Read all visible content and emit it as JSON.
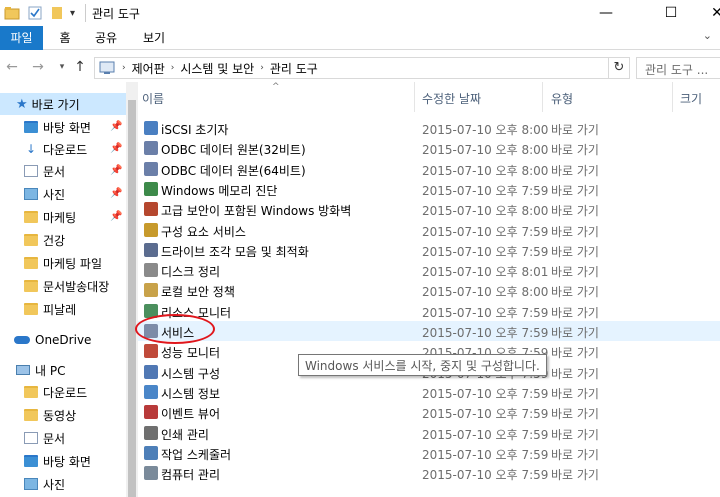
{
  "window": {
    "title": "관리 도구",
    "minimize": "—",
    "maximize": "☐",
    "close": "✕"
  },
  "ribbon": {
    "tabs": [
      "파일",
      "홈",
      "공유",
      "보기"
    ],
    "expand": "⌄"
  },
  "address": {
    "crumbs": [
      "제어판",
      "시스템 및 보안",
      "관리 도구"
    ],
    "search_placeholder": "관리 도구 ..."
  },
  "nav": {
    "quick_access": "바로 가기",
    "pinned": [
      "바탕 화면",
      "다운로드",
      "문서",
      "사진",
      "마케팅"
    ],
    "folders": [
      "건강",
      "마케팅 파일",
      "문서발송대장",
      "피날레"
    ],
    "onedrive": "OneDrive",
    "this_pc": "내 PC",
    "pc_items": [
      "다운로드",
      "동영상",
      "문서",
      "바탕 화면",
      "사진"
    ]
  },
  "columns": {
    "name": "이름",
    "date": "수정한 날짜",
    "type": "유형",
    "size": "크기"
  },
  "files": [
    {
      "name": "iSCSI 초기자",
      "date": "2015-07-10 오후 8:00",
      "type": "바로 가기",
      "color": "#4a7fc1"
    },
    {
      "name": "ODBC 데이터 원본(32비트)",
      "date": "2015-07-10 오후 8:00",
      "type": "바로 가기",
      "color": "#6b7fa8"
    },
    {
      "name": "ODBC 데이터 원본(64비트)",
      "date": "2015-07-10 오후 8:00",
      "type": "바로 가기",
      "color": "#6b7fa8"
    },
    {
      "name": "Windows 메모리 진단",
      "date": "2015-07-10 오후 7:59",
      "type": "바로 가기",
      "color": "#3d8a4a"
    },
    {
      "name": "고급 보안이 포함된 Windows 방화벽",
      "date": "2015-07-10 오후 8:00",
      "type": "바로 가기",
      "color": "#b5472e"
    },
    {
      "name": "구성 요소 서비스",
      "date": "2015-07-10 오후 7:59",
      "type": "바로 가기",
      "color": "#c79a2c"
    },
    {
      "name": "드라이브 조각 모음 및 최적화",
      "date": "2015-07-10 오후 7:59",
      "type": "바로 가기",
      "color": "#5b6c8f"
    },
    {
      "name": "디스크 정리",
      "date": "2015-07-10 오후 8:01",
      "type": "바로 가기",
      "color": "#8a8a8a"
    },
    {
      "name": "로컬 보안 정책",
      "date": "2015-07-10 오후 8:00",
      "type": "바로 가기",
      "color": "#c8a24a"
    },
    {
      "name": "리소스 모니터",
      "date": "2015-07-10 오후 7:59",
      "type": "바로 가기",
      "color": "#4b8f5d"
    },
    {
      "name": "서비스",
      "date": "2015-07-10 오후 7:59",
      "type": "바로 가기",
      "color": "#7d8ca8"
    },
    {
      "name": "성능 모니터",
      "date": "2015-07-10 오후 7:59",
      "type": "바로 가기",
      "color": "#c04a3a"
    },
    {
      "name": "시스템 구성",
      "date": "2015-07-10 오후 7:59",
      "type": "바로 가기",
      "color": "#5078b4"
    },
    {
      "name": "시스템 정보",
      "date": "2015-07-10 오후 7:59",
      "type": "바로 가기",
      "color": "#4a86c8"
    },
    {
      "name": "이벤트 뷰어",
      "date": "2015-07-10 오후 7:59",
      "type": "바로 가기",
      "color": "#b83a3a"
    },
    {
      "name": "인쇄 관리",
      "date": "2015-07-10 오후 7:59",
      "type": "바로 가기",
      "color": "#6f6f6f"
    },
    {
      "name": "작업 스케줄러",
      "date": "2015-07-10 오후 7:59",
      "type": "바로 가기",
      "color": "#4d7fb8"
    },
    {
      "name": "컴퓨터 관리",
      "date": "2015-07-10 오후 7:59",
      "type": "바로 가기",
      "color": "#7a8a9a"
    }
  ],
  "tooltip": "Windows 서비스를 시작, 중지 및 구성합니다."
}
